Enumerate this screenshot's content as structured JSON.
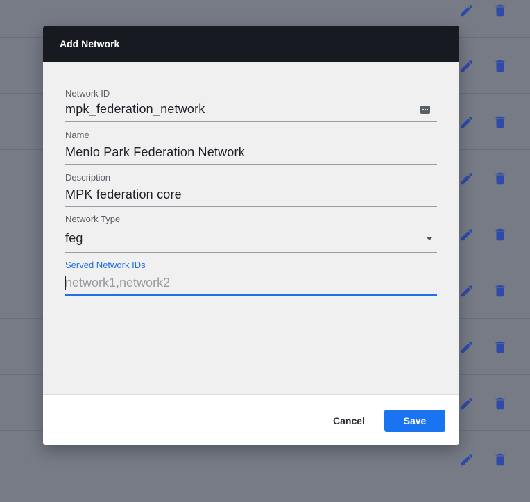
{
  "dialog": {
    "title": "Add Network",
    "fields": {
      "network_id": {
        "label": "Network ID",
        "value": "mpk_federation_network"
      },
      "name": {
        "label": "Name",
        "value": "Menlo Park Federation Network"
      },
      "description": {
        "label": "Description",
        "value": "MPK federation core"
      },
      "network_type": {
        "label": "Network Type",
        "value": "feg"
      },
      "served_network_ids": {
        "label": "Served Network IDs",
        "value": "",
        "placeholder": "network1,network2"
      }
    },
    "cancel_label": "Cancel",
    "save_label": "Save"
  },
  "background": {
    "row_icons": [
      "edit-icon",
      "delete-icon"
    ]
  },
  "colors": {
    "accent": "#1a73f0",
    "header_bg": "#171a21",
    "row_icon": "#2f4aa8"
  }
}
